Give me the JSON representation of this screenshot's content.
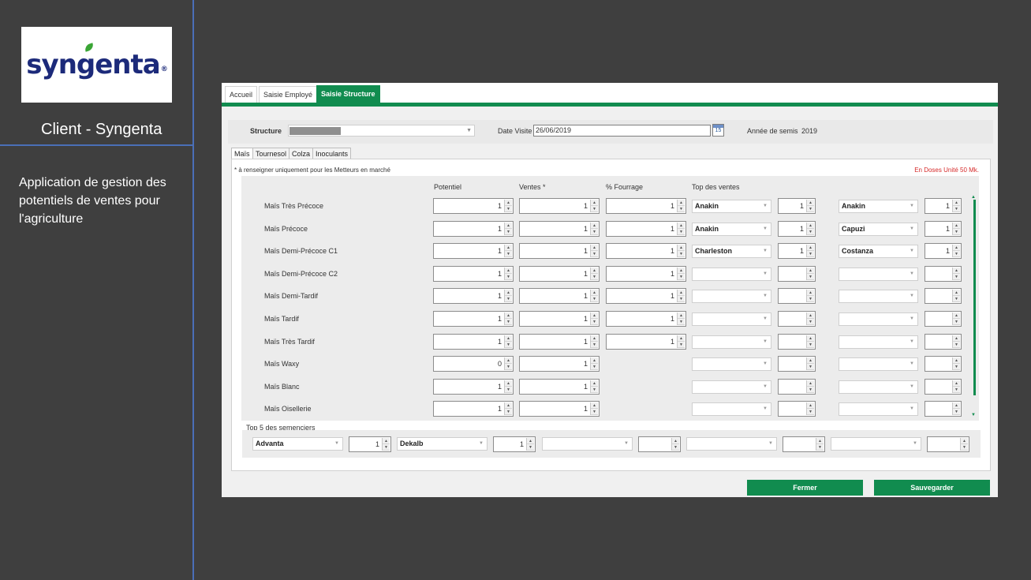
{
  "slide": {
    "logo_text": "syngenta",
    "logo_reg": "®",
    "client_title": "Client - Syngenta",
    "description": "Application de gestion des potentiels de ventes pour l'agriculture"
  },
  "app": {
    "tabs": [
      {
        "label": "Accueil",
        "active": false
      },
      {
        "label": "Saisie Employé",
        "active": false
      },
      {
        "label": "Saisie Structure",
        "active": true
      }
    ],
    "header": {
      "structure_label": "Structure",
      "date_label": "Date Visite",
      "date_value": "26/06/2019",
      "calendar_day": "15",
      "year_label": "Année de semis",
      "year_value": "2019"
    },
    "crop_tabs": [
      {
        "label": "Maïs",
        "active": true
      },
      {
        "label": "Tournesol",
        "active": false
      },
      {
        "label": "Colza",
        "active": false
      },
      {
        "label": "Inoculants",
        "active": false
      }
    ],
    "note": "* à renseigner uniquement pour les Metteurs en marché",
    "unit_note": "En Doses Unité 50 Mk.",
    "columns": {
      "potentiel": "Potentiel",
      "ventes": "Ventes *",
      "fourrage": "% Fourrage",
      "top": "Top des ventes"
    },
    "rows": [
      {
        "label": "Maïs Très Précoce",
        "potentiel": "1",
        "ventes": "1",
        "fourrage": "1",
        "top1": "Anakin",
        "top1_qty": "1",
        "top2": "Anakin",
        "top2_qty": "1"
      },
      {
        "label": "Maïs Précoce",
        "potentiel": "1",
        "ventes": "1",
        "fourrage": "1",
        "top1": "Anakin",
        "top1_qty": "1",
        "top2": "Capuzi",
        "top2_qty": "1"
      },
      {
        "label": "Maïs Demi-Précoce C1",
        "potentiel": "1",
        "ventes": "1",
        "fourrage": "1",
        "top1": "Charleston",
        "top1_qty": "1",
        "top2": "Costanza",
        "top2_qty": "1"
      },
      {
        "label": "Maïs Demi-Précoce C2",
        "potentiel": "1",
        "ventes": "1",
        "fourrage": "1",
        "top1": "",
        "top1_qty": "",
        "top2": "",
        "top2_qty": ""
      },
      {
        "label": "Maïs Demi-Tardif",
        "potentiel": "1",
        "ventes": "1",
        "fourrage": "1",
        "top1": "",
        "top1_qty": "",
        "top2": "",
        "top2_qty": ""
      },
      {
        "label": "Maïs Tardif",
        "potentiel": "1",
        "ventes": "1",
        "fourrage": "1",
        "top1": "",
        "top1_qty": "",
        "top2": "",
        "top2_qty": ""
      },
      {
        "label": "Maïs Très Tardif",
        "potentiel": "1",
        "ventes": "1",
        "fourrage": "1",
        "top1": "",
        "top1_qty": "",
        "top2": "",
        "top2_qty": ""
      },
      {
        "label": "Maïs Waxy",
        "potentiel": "0",
        "ventes": "1",
        "fourrage": null,
        "top1": "",
        "top1_qty": "",
        "top2": "",
        "top2_qty": ""
      },
      {
        "label": "Maïs Blanc",
        "potentiel": "1",
        "ventes": "1",
        "fourrage": null,
        "top1": "",
        "top1_qty": "",
        "top2": "",
        "top2_qty": ""
      },
      {
        "label": "Maïs Oisellerie",
        "potentiel": "1",
        "ventes": "1",
        "fourrage": null,
        "top1": "",
        "top1_qty": "",
        "top2": "",
        "top2_qty": ""
      }
    ],
    "top5_label": "Top 5 des semenciers",
    "top5": [
      {
        "name": "Advanta",
        "qty": "1"
      },
      {
        "name": "Dekalb",
        "qty": "1"
      },
      {
        "name": "",
        "qty": ""
      },
      {
        "name": "",
        "qty": ""
      },
      {
        "name": "",
        "qty": ""
      }
    ],
    "buttons": {
      "close": "Fermer",
      "save": "Sauvegarder"
    },
    "accent_color": "#118c4f"
  }
}
